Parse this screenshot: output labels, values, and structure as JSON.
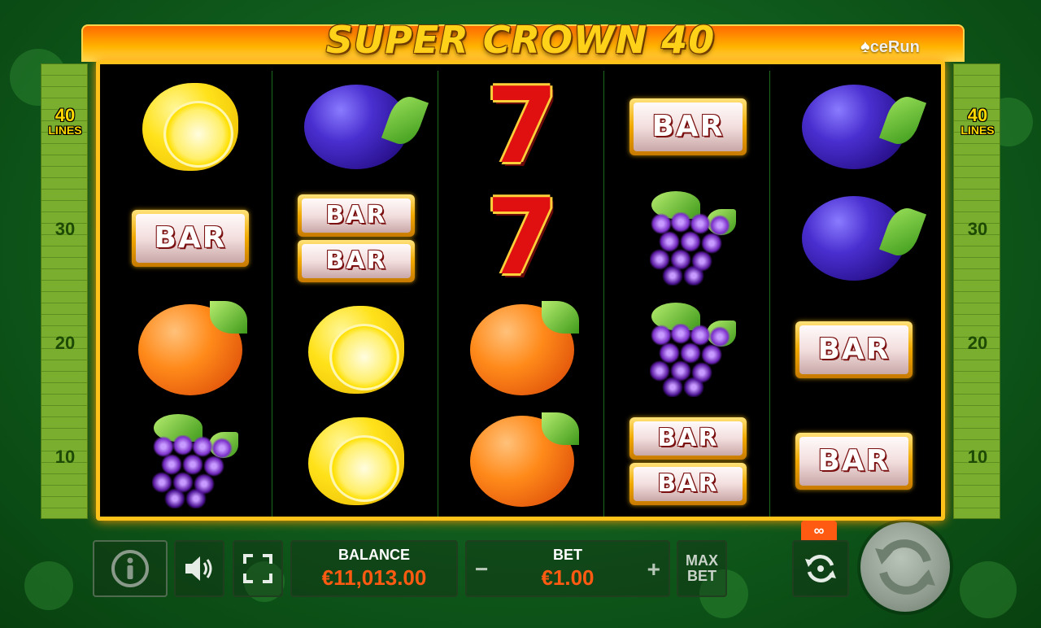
{
  "title": "SUPER CROWN 40",
  "brand": "ceRun",
  "lines_indicator": {
    "value": "40",
    "word": "LINES"
  },
  "line_ticks": [
    "30",
    "20",
    "10"
  ],
  "reels": [
    [
      "lemon",
      "bar",
      "orange",
      "grapes"
    ],
    [
      "plum",
      "double-bar",
      "lemon",
      "lemon"
    ],
    [
      "seven",
      "seven",
      "orange",
      "orange"
    ],
    [
      "bar",
      "grapes",
      "grapes",
      "double-bar"
    ],
    [
      "plum",
      "plum",
      "bar",
      "bar"
    ]
  ],
  "bar_text": "BAR",
  "seven_text": "7",
  "balance": {
    "label": "BALANCE",
    "value": "€11,013.00"
  },
  "bet": {
    "label": "BET",
    "value": "€1.00",
    "minus": "−",
    "plus": "+"
  },
  "max_bet": {
    "line1": "MAX",
    "line2": "BET"
  },
  "autoplay_badge": "∞",
  "icons": {
    "info": "info-icon",
    "sound": "speaker-icon",
    "fullscreen": "fullscreen-icon",
    "autoplay": "autoplay-icon",
    "spin": "spin-icon"
  },
  "colors": {
    "accent": "#ff5a12",
    "frame": "#ffc21a",
    "background": "#0f5a1c"
  }
}
